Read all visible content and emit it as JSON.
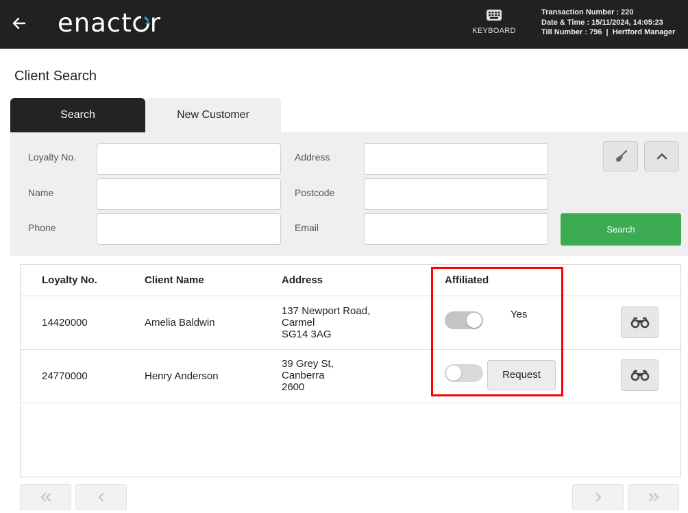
{
  "header": {
    "logo_text": "enactor",
    "keyboard_label": "KEYBOARD",
    "transaction_line": "Transaction Number : 220",
    "datetime_line": "Date & Time : 15/11/2024, 14:05:23",
    "till_line": "Till Number : 796  |  Hertford Manager"
  },
  "page": {
    "title": "Client Search"
  },
  "tabs": [
    {
      "label": "Search",
      "active": true
    },
    {
      "label": "New Customer",
      "active": false
    }
  ],
  "search_form": {
    "loyalty_label": "Loyalty No.",
    "name_label": "Name",
    "phone_label": "Phone",
    "address_label": "Address",
    "postcode_label": "Postcode",
    "email_label": "Email",
    "loyalty_value": "",
    "name_value": "",
    "phone_value": "",
    "address_value": "",
    "postcode_value": "",
    "email_value": "",
    "search_button": "Search"
  },
  "results": {
    "columns": [
      "Loyalty No.",
      "Client Name",
      "Address",
      "Affiliated"
    ],
    "rows": [
      {
        "loyalty_no": "14420000",
        "client_name": "Amelia Baldwin",
        "address_line1": "137 Newport Road,",
        "address_line2": "Carmel",
        "address_line3": "SG14 3AG",
        "affiliated": true,
        "affiliated_text": "Yes"
      },
      {
        "loyalty_no": "24770000",
        "client_name": "Henry Anderson",
        "address_line1": "39 Grey St,",
        "address_line2": "Canberra",
        "address_line3": "2600",
        "affiliated": false,
        "request_label": "Request"
      }
    ]
  },
  "colors": {
    "topbar": "#212121",
    "logo_accent": "#1aa3d9",
    "search_button": "#3cab52",
    "highlight": "#ff0000"
  },
  "icons": {
    "back": "arrow-left-icon",
    "keyboard": "keyboard-icon",
    "clear": "broom-icon",
    "collapse": "chevron-up-icon",
    "view": "binoculars-icon",
    "first_page": "double-chevron-left-icon",
    "prev_page": "chevron-left-icon",
    "next_page": "chevron-right-icon",
    "last_page": "double-chevron-right-icon"
  }
}
